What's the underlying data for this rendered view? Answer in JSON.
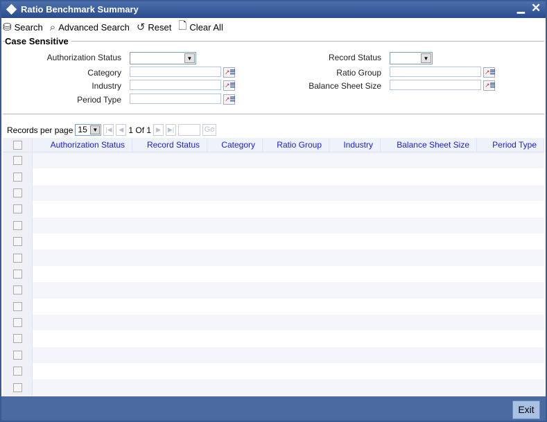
{
  "title": "Ratio Benchmark Summary",
  "toolbar": {
    "search": "Search",
    "advanced_search": "Advanced Search",
    "reset": "Reset",
    "clear_all": "Clear All"
  },
  "criteria": {
    "legend": "Case Sensitive",
    "authorization_status": "Authorization Status",
    "record_status": "Record Status",
    "category": "Category",
    "ratio_group": "Ratio Group",
    "industry": "Industry",
    "balance_sheet_size": "Balance Sheet Size",
    "period_type": "Period Type"
  },
  "pager": {
    "records_per_page_label": "Records per page",
    "records_per_page": "15",
    "page_info": "1 Of 1",
    "go": "Go"
  },
  "table": {
    "columns": [
      "Authorization Status",
      "Record Status",
      "Category",
      "Ratio Group",
      "Industry",
      "Balance Sheet Size",
      "Period Type"
    ],
    "row_count": 15
  },
  "footer": {
    "exit": "Exit"
  }
}
